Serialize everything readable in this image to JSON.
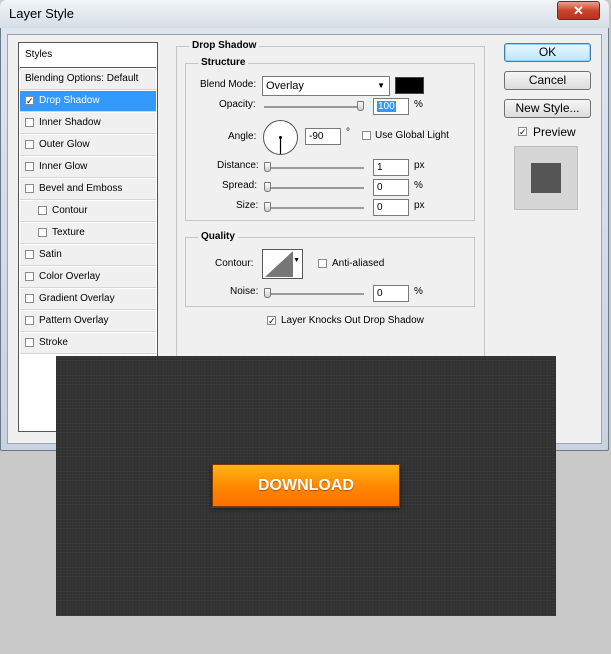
{
  "window": {
    "title": "Layer Style",
    "close_glyph": "✕"
  },
  "styles_list": {
    "header": "Styles",
    "items": [
      {
        "label": "Blending Options: Default",
        "checkbox": false,
        "checked": false,
        "selected": false,
        "indent": 0
      },
      {
        "label": "Drop Shadow",
        "checkbox": true,
        "checked": true,
        "selected": true,
        "indent": 0
      },
      {
        "label": "Inner Shadow",
        "checkbox": true,
        "checked": false,
        "selected": false,
        "indent": 0
      },
      {
        "label": "Outer Glow",
        "checkbox": true,
        "checked": false,
        "selected": false,
        "indent": 0
      },
      {
        "label": "Inner Glow",
        "checkbox": true,
        "checked": false,
        "selected": false,
        "indent": 0
      },
      {
        "label": "Bevel and Emboss",
        "checkbox": true,
        "checked": false,
        "selected": false,
        "indent": 0
      },
      {
        "label": "Contour",
        "checkbox": true,
        "checked": false,
        "selected": false,
        "indent": 1
      },
      {
        "label": "Texture",
        "checkbox": true,
        "checked": false,
        "selected": false,
        "indent": 1
      },
      {
        "label": "Satin",
        "checkbox": true,
        "checked": false,
        "selected": false,
        "indent": 0
      },
      {
        "label": "Color Overlay",
        "checkbox": true,
        "checked": false,
        "selected": false,
        "indent": 0
      },
      {
        "label": "Gradient Overlay",
        "checkbox": true,
        "checked": false,
        "selected": false,
        "indent": 0
      },
      {
        "label": "Pattern Overlay",
        "checkbox": true,
        "checked": false,
        "selected": false,
        "indent": 0
      },
      {
        "label": "Stroke",
        "checkbox": true,
        "checked": false,
        "selected": false,
        "indent": 0
      }
    ]
  },
  "drop_shadow": {
    "section_title": "Drop Shadow",
    "structure": {
      "title": "Structure",
      "blend_mode_label": "Blend Mode:",
      "blend_mode_value": "Overlay",
      "shadow_color": "#000000",
      "opacity_label": "Opacity:",
      "opacity_value": "100",
      "opacity_unit": "%",
      "angle_label": "Angle:",
      "angle_value": "-90",
      "angle_unit": "°",
      "use_global_light_label": "Use Global Light",
      "use_global_light_checked": false,
      "distance_label": "Distance:",
      "distance_value": "1",
      "distance_unit": "px",
      "spread_label": "Spread:",
      "spread_value": "0",
      "spread_unit": "%",
      "size_label": "Size:",
      "size_value": "0",
      "size_unit": "px"
    },
    "quality": {
      "title": "Quality",
      "contour_label": "Contour:",
      "anti_aliased_label": "Anti-aliased",
      "anti_aliased_checked": false,
      "noise_label": "Noise:",
      "noise_value": "0",
      "noise_unit": "%"
    },
    "knocks_out_label": "Layer Knocks Out Drop Shadow",
    "knocks_out_checked": true
  },
  "buttons": {
    "ok": "OK",
    "cancel": "Cancel",
    "new_style": "New Style...",
    "preview_label": "Preview",
    "preview_checked": true
  },
  "canvas": {
    "button_label": "DOWNLOAD",
    "background_color": "#333333",
    "button_color": "#ff8a00"
  },
  "sliders": {
    "opacity": 1.0,
    "distance": 0.0,
    "spread": 0.0,
    "size": 0.0,
    "noise": 0.0
  }
}
